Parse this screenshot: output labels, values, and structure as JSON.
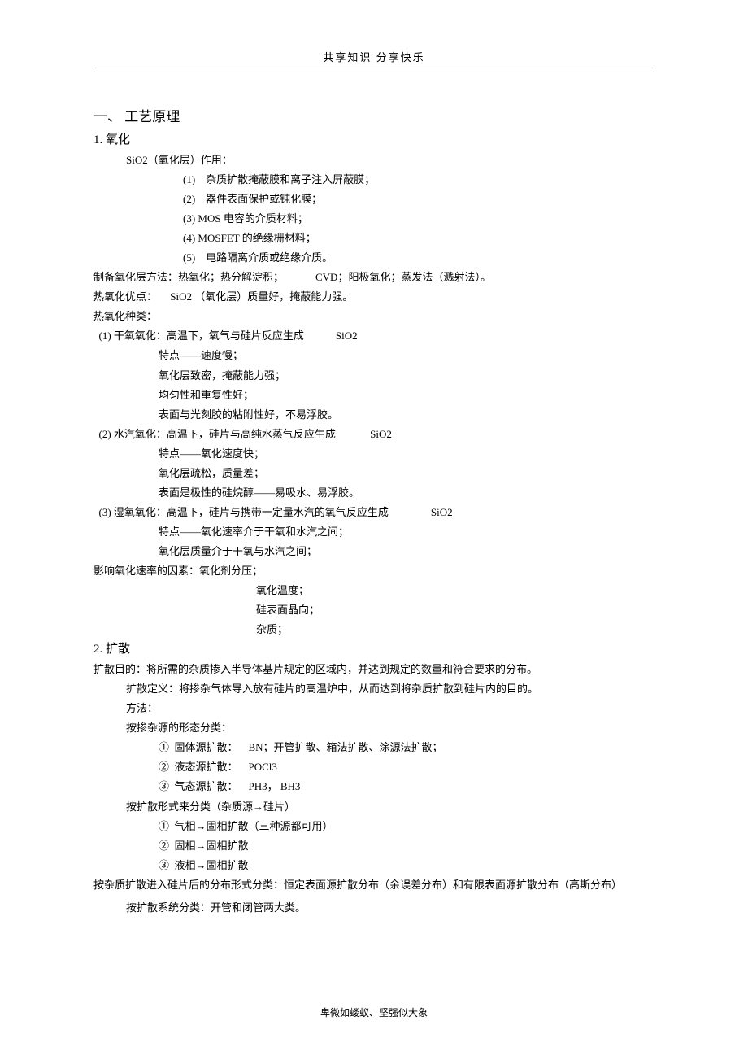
{
  "header": {
    "left": "共享知识",
    "right": "分享快乐"
  },
  "sections": {
    "s1_title": "一、   工艺原理",
    "s1_1_title": "1.   氧化",
    "s1_1_intro": "SiO2（氧化层）作用：",
    "s1_1_items": [
      "(1)    杂质扩散掩蔽膜和离子注入屏蔽膜；",
      "(2)    器件表面保护或钝化膜；",
      "(3) MOS 电容的介质材料；",
      "(4) MOSFET 的绝缘栅材料；",
      "(5)    电路隔离介质或绝缘介质。"
    ],
    "s1_1_method": "制备氧化层方法：热氧化；热分解淀积；            CVD；阳极氧化；蒸发法（溅射法）。",
    "s1_1_adv": "热氧化优点：     SiO2 （氧化层）质量好，掩蔽能力强。",
    "s1_1_types_title": "热氧化种类：",
    "s1_1_types": [
      {
        "title": "  (1) 干氧氧化：高温下，氧气与硅片反应生成            SiO2",
        "points": [
          "特点——速度慢；",
          "氧化层致密，掩蔽能力强；",
          "均匀性和重复性好；",
          "表面与光刻胶的粘附性好，不易浮胶。"
        ]
      },
      {
        "title": "  (2) 水汽氧化：高温下，硅片与高纯水蒸气反应生成             SiO2",
        "points": [
          "特点——氧化速度快；",
          "氧化层疏松，质量差；",
          "表面是极性的硅烷醇——易吸水、易浮胶。"
        ]
      },
      {
        "title": "  (3) 湿氧氧化：高温下，硅片与携带一定量水汽的氧气反应生成                SiO2",
        "points": [
          "特点——氧化速率介于干氧和水汽之间；",
          "氧化层质量介于干氧与水汽之间；"
        ]
      }
    ],
    "s1_1_factors_title": "影响氧化速率的因素：氧化剂分压；",
    "s1_1_factors": [
      "氧化温度；",
      "硅表面晶向；",
      "杂质；"
    ],
    "s1_2_title": "2.   扩散",
    "s1_2_purpose": "      扩散目的：将所需的杂质掺入半导体基片规定的区域内，并达到规定的数量和符合要求的分布。",
    "s1_2_def": "扩散定义：将掺杂气体导入放有硅片的高温炉中，从而达到将杂质扩散到硅片内的目的。",
    "s1_2_method": "方法：",
    "s1_2_cat1_title": "按掺杂源的形态分类：",
    "s1_2_cat1": [
      "①  固体源扩散：    BN；开管扩散、箱法扩散、涂源法扩散；",
      "②  液态源扩散：    POCl3",
      "③  气态源扩散：    PH3， BH3"
    ],
    "s1_2_cat2_title": "按扩散形式来分类（杂质源→硅片）",
    "s1_2_cat2": [
      "①  气相→固相扩散（三种源都可用）",
      "②  固相→固相扩散",
      "③  液相→固相扩散"
    ],
    "s1_2_cat3": "       按杂质扩散进入硅片后的分布形式分类：恒定表面源扩散分布（余误差分布）和有限表面源扩散分布（高斯分布）",
    "s1_2_cat4": "按扩散系统分类：开管和闭管两大类。"
  },
  "footer": "卑微如蝼蚁、坚强似大象"
}
